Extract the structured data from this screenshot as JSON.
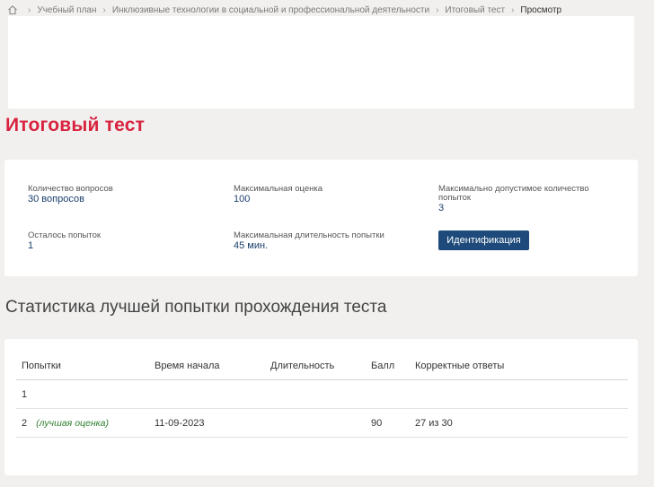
{
  "breadcrumb": {
    "items": [
      "Учебный план",
      "Инклюзивные технологии в социальной и профессиональной деятельности",
      "Итоговый тест"
    ],
    "current": "Просмотр"
  },
  "page": {
    "title": "Итоговый тест"
  },
  "info": {
    "questions_label": "Количество вопросов",
    "questions_value": "30 вопросов",
    "max_score_label": "Максимальная оценка",
    "max_score_value": "100",
    "max_attempts_label": "Максимально допустимое количество попыток",
    "max_attempts_value": "3",
    "remaining_label": "Осталось попыток",
    "remaining_value": "1",
    "duration_label": "Максимальная длительность попытки",
    "duration_value": "45 мин.",
    "identify_button": "Идентификация"
  },
  "stats": {
    "title": "Статистика лучшей попытки прохождения теста",
    "columns": [
      "Попытки",
      "Время начала",
      "Длительность",
      "Балл",
      "Корректные ответы"
    ],
    "rows": [
      {
        "attempt": "1",
        "note": "",
        "start": "",
        "duration": "",
        "score": "",
        "correct": ""
      },
      {
        "attempt": "2",
        "note": "(лучшая оценка)",
        "start": "11-09-2023",
        "duration": "",
        "score": "90",
        "correct": "27 из 30"
      }
    ]
  },
  "colors": {
    "title_red": "#d8233f",
    "button_blue": "#1d4a7a",
    "value_blue": "#1a3f6b",
    "best_green": "#2d7d2d"
  }
}
